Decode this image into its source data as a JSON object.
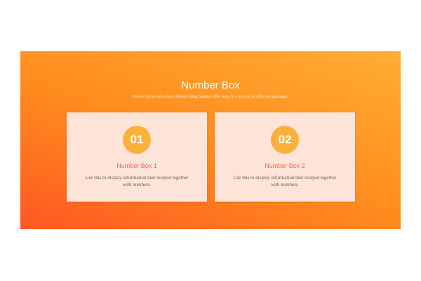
{
  "section": {
    "title": "Number Box",
    "subtitle": "Present information best relayed using numbers like steps in a process or different packages."
  },
  "cards": [
    {
      "number": "01",
      "title": "Number Box 1",
      "text": "Use this to display information best relayed together with numbers."
    },
    {
      "number": "02",
      "title": "Number Box 2",
      "text": "Use this to display information best relayed together with numbers."
    }
  ],
  "colors": {
    "gradient_start": "#ff5722",
    "gradient_end": "#ffad34",
    "badge": "#fbb03b",
    "card_title": "#f26a45",
    "card_background": "#fde3d8"
  }
}
